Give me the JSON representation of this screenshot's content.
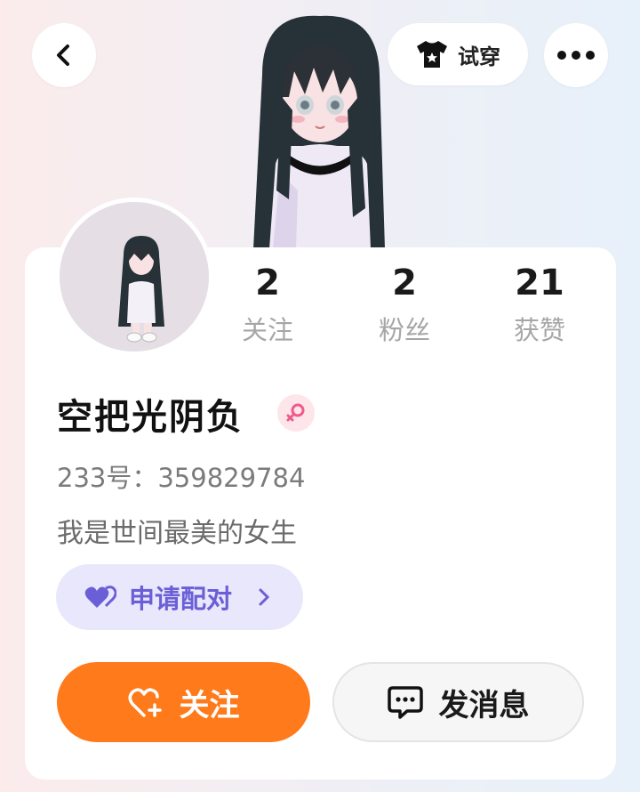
{
  "header": {
    "back_icon": "chevron-left-icon",
    "tryon_label": "试穿",
    "tryon_icon": "shirt-icon",
    "more_icon": "more-dots-icon"
  },
  "profile": {
    "username": "空把光阴负",
    "gender": "female",
    "user_id": "233号：359829784",
    "bio": "我是世间最美的女生"
  },
  "stats": [
    {
      "value": "2",
      "label": "关注"
    },
    {
      "value": "2",
      "label": "粉丝"
    },
    {
      "value": "21",
      "label": "获赞"
    }
  ],
  "actions": {
    "match_label": "申请配对",
    "follow_label": "关注",
    "message_label": "发消息"
  },
  "colors": {
    "follow_bg": "#ff7a1a",
    "match_bg": "#e9e7fb",
    "match_text": "#6a5fd6",
    "female_badge": "#f05a8c"
  }
}
